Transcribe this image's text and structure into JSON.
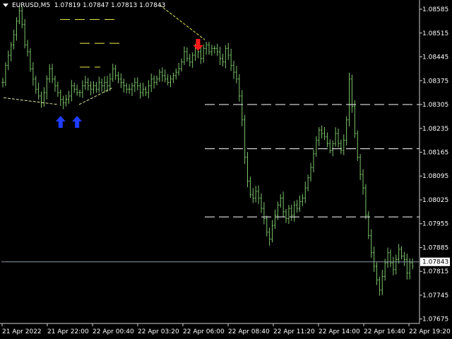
{
  "window": {
    "symbol_timeframe": "EURUSD,M5",
    "ohlc": "1.07819 1.07847 1.07813 1.07843"
  },
  "chart_data": {
    "type": "line",
    "style": "bars",
    "bar_color": "#7cc36a",
    "background": "#000000",
    "y_ticks": [
      "1.08585",
      "1.08515",
      "1.08445",
      "1.08375",
      "1.08305",
      "1.08235",
      "1.08165",
      "1.08095",
      "1.08025",
      "1.07955",
      "1.07885",
      "1.07815",
      "1.07745",
      "1.07675"
    ],
    "y_tick_values": [
      1.08585,
      1.08515,
      1.08445,
      1.08375,
      1.08305,
      1.08235,
      1.08165,
      1.08095,
      1.08025,
      1.07955,
      1.07885,
      1.07815,
      1.07745,
      1.07675
    ],
    "ylim": [
      1.07662,
      1.08612
    ],
    "x_ticks": [
      "21 Apr 2022",
      "21 Apr 22:00",
      "22 Apr 00:40",
      "22 Apr 03:20",
      "22 Apr 06:00",
      "22 Apr 08:40",
      "22 Apr 11:20",
      "22 Apr 14:00",
      "22 Apr 16:40",
      "22 Apr 19:20"
    ],
    "current_price": 1.07843,
    "current_price_label": "1.07843",
    "price_series": [
      1.0837,
      1.0842,
      1.0845,
      1.0848,
      1.0851,
      1.0855,
      1.0858,
      1.0854,
      1.0848,
      1.0846,
      1.0841,
      1.0838,
      1.0835,
      1.0833,
      1.0831,
      1.0834,
      1.0838,
      1.0841,
      1.0838,
      1.0836,
      1.0834,
      1.0832,
      1.0831,
      1.0832,
      1.0833,
      1.0836,
      1.0835,
      1.0834,
      1.0834,
      1.0836,
      1.0837,
      1.0836,
      1.0835,
      1.0836,
      1.0835,
      1.0837,
      1.0836,
      1.0837,
      1.0836,
      1.0838,
      1.0841,
      1.0839,
      1.0838,
      1.0837,
      1.0836,
      1.0835,
      1.0835,
      1.0836,
      1.0837,
      1.0836,
      1.0834,
      1.0835,
      1.0834,
      1.0836,
      1.0838,
      1.0837,
      1.0838,
      1.084,
      1.0839,
      1.0838,
      1.0837,
      1.0838,
      1.0839,
      1.084,
      1.0841,
      1.0843,
      1.0846,
      1.0844,
      1.0843,
      1.0845,
      1.0847,
      1.0846,
      1.0844,
      1.0847,
      1.0848,
      1.0846,
      1.0847,
      1.0847,
      1.0846,
      1.0844,
      1.0843,
      1.0847,
      1.0845,
      1.0842,
      1.084,
      1.0838,
      1.0833,
      1.0826,
      1.0815,
      1.0808,
      1.0804,
      1.0803,
      1.0805,
      1.0803,
      1.08,
      1.0797,
      1.0793,
      1.0791,
      1.0795,
      1.0798,
      1.0801,
      1.0803,
      1.0799,
      1.0797,
      1.08,
      1.0798,
      1.0801,
      1.08,
      1.0802,
      1.0803,
      1.0806,
      1.0809,
      1.0812,
      1.0816,
      1.082,
      1.0823,
      1.0822,
      1.0821,
      1.0819,
      1.0817,
      1.0819,
      1.0822,
      1.0819,
      1.0817,
      1.082,
      1.0826,
      1.0838,
      1.083,
      1.0822,
      1.0815,
      1.081,
      1.0806,
      1.0798,
      1.0792,
      1.0787,
      1.0783,
      1.0779,
      1.0776,
      1.078,
      1.0784,
      1.0787,
      1.0784,
      1.0782,
      1.0785,
      1.0788,
      1.0786,
      1.0785,
      1.0781,
      1.0784,
      1.0783
    ],
    "support_levels": [
      {
        "label": "",
        "value": 1.08305,
        "style": "dashed",
        "color": "#ffffff"
      },
      {
        "label": "",
        "value": 1.08175,
        "style": "dashed",
        "color": "#ffffff"
      },
      {
        "label": "",
        "value": 1.07975,
        "style": "dashed",
        "color": "#ffffff"
      }
    ],
    "yellow_levels": [
      {
        "value": 1.08555,
        "segments": 3
      },
      {
        "value": 1.08485,
        "segments": 3
      },
      {
        "value": 1.08415,
        "segments": 2
      }
    ],
    "signals": [
      {
        "type": "buy",
        "color": "#1f3cff",
        "icon": "arrow-up-icon",
        "bar_index": 21
      },
      {
        "type": "buy",
        "color": "#1f3cff",
        "icon": "arrow-up-icon",
        "bar_index": 27
      },
      {
        "type": "sell",
        "color": "#ff1a1a",
        "icon": "arrow-down-icon",
        "bar_index": 71
      }
    ],
    "grid": false
  }
}
